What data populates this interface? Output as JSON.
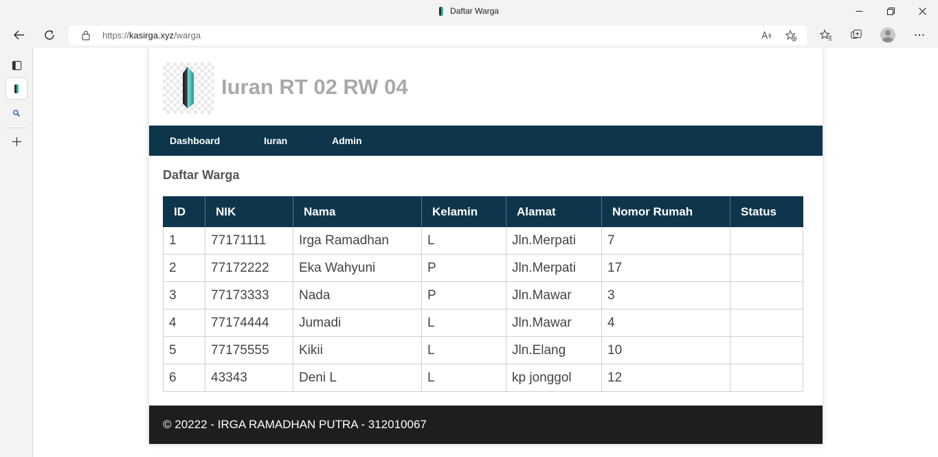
{
  "window": {
    "title": "Daftar Warga",
    "icons": [
      "minimize-icon",
      "maximize-icon",
      "close-icon"
    ]
  },
  "browser": {
    "url_scheme": "https://",
    "url_host": "kasirga.xyz",
    "url_path": "/warga",
    "icons": [
      "back-arrow-icon",
      "refresh-icon",
      "lock-icon",
      "read-aloud-icon",
      "add-favorite-icon",
      "favorites-icon",
      "collections-icon",
      "profile-avatar-icon",
      "more-options-icon"
    ]
  },
  "sidebar": {
    "icons": [
      "tab-actions-icon",
      "site-tab-icon",
      "search-icon",
      "plus-icon"
    ]
  },
  "site": {
    "title": "Iuran RT 02 RW 04",
    "logo": "crystal-logo-icon"
  },
  "nav": {
    "items": [
      {
        "label": "Dashboard"
      },
      {
        "label": "Iuran"
      },
      {
        "label": "Admin"
      }
    ]
  },
  "main": {
    "heading": "Daftar Warga"
  },
  "table": {
    "headers": [
      "ID",
      "NIK",
      "Nama",
      "Kelamin",
      "Alamat",
      "Nomor Rumah",
      "Status"
    ],
    "rows": [
      {
        "id": "1",
        "nik": "77171111",
        "nama": "Irga Ramadhan",
        "kelamin": "L",
        "alamat": "Jln.Merpati",
        "nomor_rumah": "7",
        "status": ""
      },
      {
        "id": "2",
        "nik": "77172222",
        "nama": "Eka Wahyuni",
        "kelamin": "P",
        "alamat": "Jln.Merpati",
        "nomor_rumah": "17",
        "status": ""
      },
      {
        "id": "3",
        "nik": "77173333",
        "nama": "Nada",
        "kelamin": "P",
        "alamat": "Jln.Mawar",
        "nomor_rumah": "3",
        "status": ""
      },
      {
        "id": "4",
        "nik": "77174444",
        "nama": "Jumadi",
        "kelamin": "L",
        "alamat": "Jln.Mawar",
        "nomor_rumah": "4",
        "status": ""
      },
      {
        "id": "5",
        "nik": "77175555",
        "nama": "Kikii",
        "kelamin": "L",
        "alamat": "Jln.Elang",
        "nomor_rumah": "10",
        "status": ""
      },
      {
        "id": "6",
        "nik": "43343",
        "nama": "Deni L",
        "kelamin": "L",
        "alamat": "kp jonggol",
        "nomor_rumah": "12",
        "status": ""
      }
    ]
  },
  "footer": {
    "text": "© 20222 - IRGA RAMADHAN PUTRA - 312010067"
  },
  "colors": {
    "navbar": "#0d364c",
    "table_header": "#0d364c",
    "footer": "#1e1e1e",
    "site_title": "#a9a9a9",
    "heading": "#555555"
  }
}
